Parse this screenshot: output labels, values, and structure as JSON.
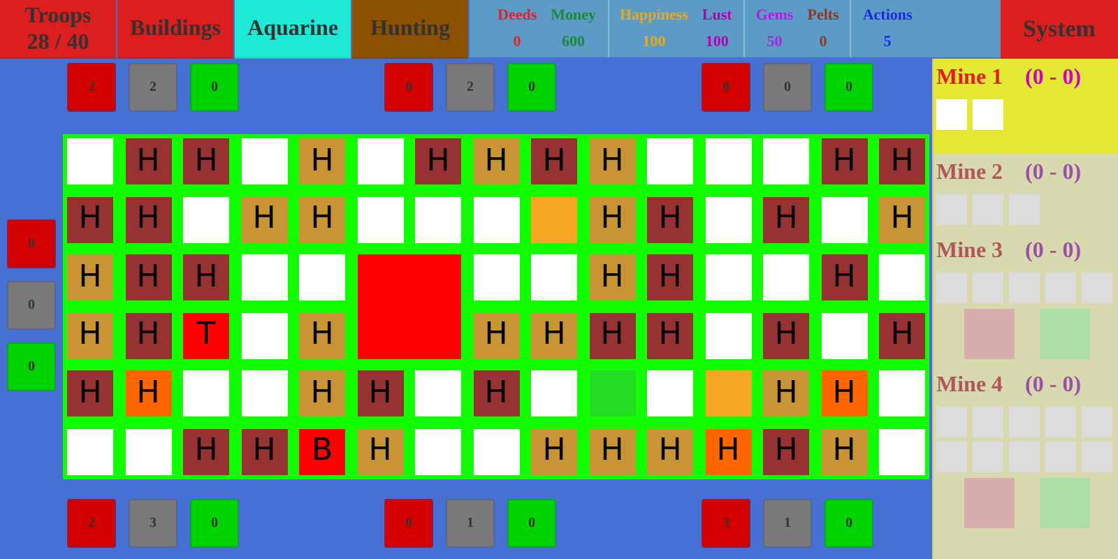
{
  "tabs": [
    {
      "label": "Troops",
      "sublabel": "28 / 40",
      "color": "#dc1e1e"
    },
    {
      "label": "Buildings",
      "color": "#dc1e1e"
    },
    {
      "label": "Aquarine",
      "color": "#1de9d4"
    },
    {
      "label": "Hunting",
      "color": "#8b5000"
    }
  ],
  "stats": [
    [
      {
        "label": "Deeds",
        "value": "0",
        "color": "#e0202a"
      },
      {
        "label": "Money",
        "value": "600",
        "color": "#1a8a3a"
      }
    ],
    [
      {
        "label": "Happiness",
        "value": "100",
        "color": "#e8a820"
      },
      {
        "label": "Lust",
        "value": "100",
        "color": "#b000b0"
      }
    ],
    [
      {
        "label": "Gems",
        "value": "50",
        "color": "#b020e0"
      },
      {
        "label": "Pelts",
        "value": "0",
        "color": "#8a3a20"
      }
    ],
    [
      {
        "label": "Actions",
        "value": "5",
        "color": "#1a2ae0"
      }
    ]
  ],
  "system_button": "System",
  "top_counters": [
    [
      {
        "value": "2",
        "color": "#d40000"
      },
      {
        "value": "2",
        "color": "#7a7a7a"
      },
      {
        "value": "0",
        "color": "#00d400"
      }
    ],
    [
      {
        "value": "0",
        "color": "#d40000"
      },
      {
        "value": "2",
        "color": "#7a7a7a"
      },
      {
        "value": "0",
        "color": "#00d400"
      }
    ],
    [
      {
        "value": "0",
        "color": "#d40000"
      },
      {
        "value": "0",
        "color": "#7a7a7a"
      },
      {
        "value": "0",
        "color": "#00d400"
      }
    ]
  ],
  "left_counters": [
    {
      "value": "0",
      "color": "#d40000"
    },
    {
      "value": "0",
      "color": "#7a7a7a"
    },
    {
      "value": "0",
      "color": "#00d400"
    }
  ],
  "bottom_counters": [
    [
      {
        "value": "2",
        "color": "#d40000"
      },
      {
        "value": "3",
        "color": "#7a7a7a"
      },
      {
        "value": "0",
        "color": "#00d400"
      }
    ],
    [
      {
        "value": "0",
        "color": "#d40000"
      },
      {
        "value": "1",
        "color": "#7a7a7a"
      },
      {
        "value": "0",
        "color": "#00d400"
      }
    ],
    [
      {
        "value": "3",
        "color": "#d40000"
      },
      {
        "value": "1",
        "color": "#7a7a7a"
      },
      {
        "value": "0",
        "color": "#00d400"
      }
    ]
  ],
  "grid": [
    {
      "kind": "cell",
      "color": "#ffffff"
    },
    {
      "kind": "cell",
      "color": "#963232",
      "label": "H"
    },
    {
      "kind": "cell",
      "color": "#963232",
      "label": "H"
    },
    {
      "kind": "cell",
      "color": "#ffffff"
    },
    {
      "kind": "cell",
      "color": "#c99433",
      "label": "H"
    },
    {
      "kind": "cell",
      "color": "#ffffff"
    },
    {
      "kind": "cell",
      "color": "#963232",
      "label": "H"
    },
    {
      "kind": "cell",
      "color": "#c99433",
      "label": "H"
    },
    {
      "kind": "cell",
      "color": "#963232",
      "label": "H"
    },
    {
      "kind": "cell",
      "color": "#c99433",
      "label": "H"
    },
    {
      "kind": "cell",
      "color": "#ffffff"
    },
    {
      "kind": "cell",
      "color": "#ffffff"
    },
    {
      "kind": "cell",
      "color": "#ffffff"
    },
    {
      "kind": "cell",
      "color": "#963232",
      "label": "H"
    },
    {
      "kind": "cell",
      "color": "#963232",
      "label": "H"
    },
    {
      "kind": "cell",
      "color": "#963232",
      "label": "H"
    },
    {
      "kind": "cell",
      "color": "#963232",
      "label": "H"
    },
    {
      "kind": "cell",
      "color": "#ffffff"
    },
    {
      "kind": "cell",
      "color": "#c99433",
      "label": "H"
    },
    {
      "kind": "cell",
      "color": "#c99433",
      "label": "H"
    },
    {
      "kind": "cell",
      "color": "#ffffff"
    },
    {
      "kind": "cell",
      "color": "#ffffff"
    },
    {
      "kind": "cell",
      "color": "#ffffff"
    },
    {
      "kind": "cell",
      "color": "#f5a623"
    },
    {
      "kind": "cell",
      "color": "#c99433",
      "label": "H"
    },
    {
      "kind": "cell",
      "color": "#963232",
      "label": "H"
    },
    {
      "kind": "cell",
      "color": "#ffffff"
    },
    {
      "kind": "cell",
      "color": "#963232",
      "label": "H"
    },
    {
      "kind": "cell",
      "color": "#ffffff"
    },
    {
      "kind": "cell",
      "color": "#c99433",
      "label": "H"
    },
    {
      "kind": "cell",
      "color": "#c99433",
      "label": "H"
    },
    {
      "kind": "cell",
      "color": "#963232",
      "label": "H"
    },
    {
      "kind": "cell",
      "color": "#963232",
      "label": "H"
    },
    {
      "kind": "cell",
      "color": "#ffffff"
    },
    {
      "kind": "cell",
      "color": "#ffffff"
    },
    {
      "kind": "large",
      "color": "#ff0000"
    },
    {
      "kind": "cell",
      "color": "#ffffff"
    },
    {
      "kind": "cell",
      "color": "#ffffff"
    },
    {
      "kind": "cell",
      "color": "#c99433",
      "label": "H"
    },
    {
      "kind": "cell",
      "color": "#963232",
      "label": "H"
    },
    {
      "kind": "cell",
      "color": "#ffffff"
    },
    {
      "kind": "cell",
      "color": "#ffffff"
    },
    {
      "kind": "cell",
      "color": "#963232",
      "label": "H"
    },
    {
      "kind": "cell",
      "color": "#ffffff"
    },
    {
      "kind": "cell",
      "color": "#c99433",
      "label": "H"
    },
    {
      "kind": "cell",
      "color": "#963232",
      "label": "H"
    },
    {
      "kind": "cell",
      "color": "#ff0000",
      "label": "T"
    },
    {
      "kind": "cell",
      "color": "#ffffff"
    },
    {
      "kind": "cell",
      "color": "#c99433",
      "label": "H"
    },
    {
      "kind": "cell",
      "color": "#c99433",
      "label": "H"
    },
    {
      "kind": "cell",
      "color": "#c99433",
      "label": "H"
    },
    {
      "kind": "cell",
      "color": "#963232",
      "label": "H"
    },
    {
      "kind": "cell",
      "color": "#963232",
      "label": "H"
    },
    {
      "kind": "cell",
      "color": "#ffffff"
    },
    {
      "kind": "cell",
      "color": "#963232",
      "label": "H"
    },
    {
      "kind": "cell",
      "color": "#ffffff"
    },
    {
      "kind": "cell",
      "color": "#963232",
      "label": "H"
    },
    {
      "kind": "cell",
      "color": "#963232",
      "label": "H"
    },
    {
      "kind": "cell",
      "color": "#ff6600",
      "label": "H"
    },
    {
      "kind": "cell",
      "color": "#ffffff"
    },
    {
      "kind": "cell",
      "color": "#ffffff"
    },
    {
      "kind": "cell",
      "color": "#c99433",
      "label": "H"
    },
    {
      "kind": "cell",
      "color": "#963232",
      "label": "H"
    },
    {
      "kind": "cell",
      "color": "#ffffff"
    },
    {
      "kind": "cell",
      "color": "#963232",
      "label": "H"
    },
    {
      "kind": "cell",
      "color": "#ffffff"
    },
    {
      "kind": "cell",
      "color": "#22dd22"
    },
    {
      "kind": "cell",
      "color": "#ffffff"
    },
    {
      "kind": "cell",
      "color": "#f5a623"
    },
    {
      "kind": "cell",
      "color": "#c99433",
      "label": "H"
    },
    {
      "kind": "cell",
      "color": "#ff6600",
      "label": "H"
    },
    {
      "kind": "cell",
      "color": "#ffffff"
    },
    {
      "kind": "cell",
      "color": "#ffffff"
    },
    {
      "kind": "cell",
      "color": "#ffffff"
    },
    {
      "kind": "cell",
      "color": "#963232",
      "label": "H"
    },
    {
      "kind": "cell",
      "color": "#963232",
      "label": "H"
    },
    {
      "kind": "cell",
      "color": "#ff0000",
      "label": "B"
    },
    {
      "kind": "cell",
      "color": "#c99433",
      "label": "H"
    },
    {
      "kind": "cell",
      "color": "#ffffff"
    },
    {
      "kind": "cell",
      "color": "#ffffff"
    },
    {
      "kind": "cell",
      "color": "#c99433",
      "label": "H"
    },
    {
      "kind": "cell",
      "color": "#c99433",
      "label": "H"
    },
    {
      "kind": "cell",
      "color": "#c99433",
      "label": "H"
    },
    {
      "kind": "cell",
      "color": "#ff6600",
      "label": "H"
    },
    {
      "kind": "cell",
      "color": "#963232",
      "label": "H"
    },
    {
      "kind": "cell",
      "color": "#c99433",
      "label": "H"
    },
    {
      "kind": "cell",
      "color": "#ffffff"
    }
  ],
  "mines": [
    {
      "name": "Mine 1",
      "range": "(0 - 0)",
      "disabled": false,
      "slots": [
        {
          "kind": "slot"
        },
        {
          "kind": "slot"
        }
      ]
    },
    {
      "name": "Mine 2",
      "range": "(0 - 0)",
      "disabled": true,
      "slots": [
        {
          "kind": "slot"
        },
        {
          "kind": "slot"
        },
        {
          "kind": "slot"
        }
      ]
    },
    {
      "name": "Mine 3",
      "range": "(0 - 0)",
      "disabled": true,
      "slots": [
        {
          "kind": "slot"
        },
        {
          "kind": "slot"
        },
        {
          "kind": "slot"
        },
        {
          "kind": "slot"
        },
        {
          "kind": "slot"
        }
      ],
      "buttons": [
        {
          "color": "#d8adad"
        },
        {
          "color": "#ade0a8"
        }
      ]
    },
    {
      "name": "Mine 4",
      "range": "(0 - 0)",
      "disabled": true,
      "slots": [
        {
          "kind": "slot"
        },
        {
          "kind": "slot"
        },
        {
          "kind": "slot"
        },
        {
          "kind": "slot"
        },
        {
          "kind": "slot"
        },
        {
          "kind": "slot"
        },
        {
          "kind": "slot"
        },
        {
          "kind": "slot"
        },
        {
          "kind": "slot"
        },
        {
          "kind": "slot"
        }
      ],
      "buttons": [
        {
          "color": "#d8adad"
        },
        {
          "color": "#ade0a8"
        }
      ]
    }
  ]
}
